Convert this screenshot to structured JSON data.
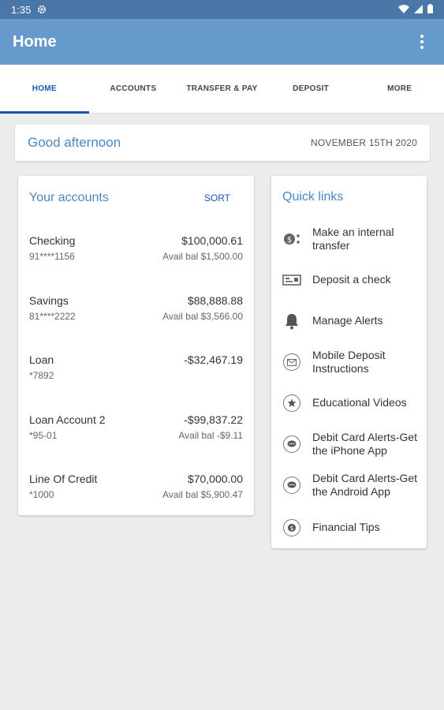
{
  "statusbar": {
    "time": "1:35"
  },
  "appbar": {
    "title": "Home"
  },
  "tabs": [
    {
      "label": "HOME",
      "active": true
    },
    {
      "label": "ACCOUNTS"
    },
    {
      "label": "TRANSFER & PAY"
    },
    {
      "label": "DEPOSIT"
    },
    {
      "label": "MORE"
    }
  ],
  "greeting": {
    "text": "Good afternoon",
    "date": "NOVEMBER 15TH 2020"
  },
  "accounts": {
    "title": "Your accounts",
    "sort_label": "SORT",
    "items": [
      {
        "name": "Checking",
        "number": "91****1156",
        "amount": "$100,000.61",
        "avail": "Avail bal $1,500.00"
      },
      {
        "name": "Savings",
        "number": "81****2222",
        "amount": "$88,888.88",
        "avail": "Avail bal $3,566.00"
      },
      {
        "name": "Loan",
        "number": "*7892",
        "amount": "-$32,467.19",
        "avail": ""
      },
      {
        "name": "Loan Account 2",
        "number": "*95-01",
        "amount": "-$99,837.22",
        "avail": "Avail bal -$9.11"
      },
      {
        "name": "Line Of Credit",
        "number": "*1000",
        "amount": "$70,000.00",
        "avail": "Avail bal $5,900.47"
      }
    ]
  },
  "quick_links": {
    "title": "Quick links",
    "items": [
      {
        "label": "Make an internal transfer",
        "icon": "transfer-icon"
      },
      {
        "label": "Deposit a check",
        "icon": "check-icon"
      },
      {
        "label": "Manage Alerts",
        "icon": "bell-icon"
      },
      {
        "label": "Mobile Deposit Instructions",
        "icon": "mail-icon"
      },
      {
        "label": "Educational Videos",
        "icon": "star-icon"
      },
      {
        "label": "Debit Card Alerts-Get the iPhone App",
        "icon": "chat-icon"
      },
      {
        "label": "Debit Card Alerts-Get the Android App",
        "icon": "chat-icon"
      },
      {
        "label": "Financial Tips",
        "icon": "dollar-icon"
      }
    ]
  }
}
